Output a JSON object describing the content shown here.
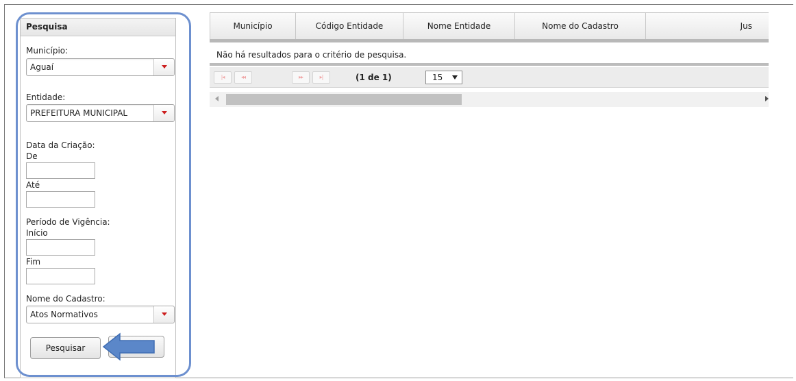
{
  "sidebar": {
    "title": "Pesquisa",
    "municipio": {
      "label": "Município:",
      "value": "Aguaí"
    },
    "entidade": {
      "label": "Entidade:",
      "value": "PREFEITURA MUNICIPAL"
    },
    "data_criacao": {
      "label": "Data da Criação:",
      "de_label": "De",
      "ate_label": "Até",
      "de_value": "",
      "ate_value": ""
    },
    "periodo_vigencia": {
      "label": "Período de Vigência:",
      "inicio_label": "Início",
      "fim_label": "Fim",
      "inicio_value": "",
      "fim_value": ""
    },
    "nome_cadastro": {
      "label": "Nome do Cadastro:",
      "value": "Atos Normativos"
    },
    "search_button": "Pesquisar",
    "clear_button": ""
  },
  "table": {
    "columns": [
      "Município",
      "Código Entidade",
      "Nome Entidade",
      "Nome do Cadastro",
      "Jus"
    ],
    "empty_message": "Não há resultados para o critério de pesquisa.",
    "pager": {
      "first": "|◂",
      "prev": "◂◂",
      "next": "▸▸",
      "last": "▸|",
      "page_info": "(1 de 1)",
      "rows_per_page": "15"
    }
  },
  "colors": {
    "highlight": "#6d90cf",
    "arrow": "#5b87c9",
    "dropdown_arrow": "#cc1f1f"
  },
  "icons": [
    "dropdown-arrow-icon",
    "callout-arrow-icon",
    "scroll-left-icon",
    "scroll-right-icon"
  ]
}
